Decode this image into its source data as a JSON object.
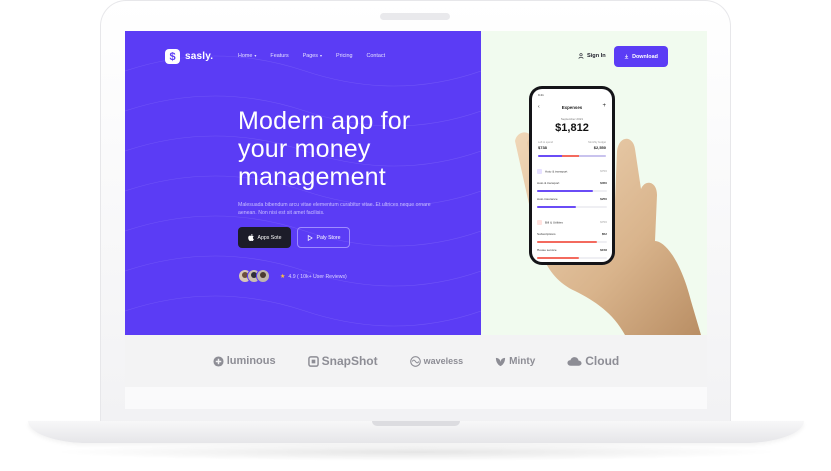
{
  "nav": {
    "logo": "sasly.",
    "logo_mark": "$",
    "items": [
      {
        "label": "Home",
        "has_caret": true
      },
      {
        "label": "Featurs",
        "has_caret": false
      },
      {
        "label": "Pages",
        "has_caret": true
      },
      {
        "label": "Pricing",
        "has_caret": false
      },
      {
        "label": "Contact",
        "has_caret": false
      }
    ],
    "signin": "Sign In",
    "download": "Download"
  },
  "hero": {
    "title_lines": [
      "Modern app for",
      "your money",
      "management"
    ],
    "description": "Malesuada bibendum arcu vitae elementum curabitur vitae. Et ultrices neque ornare aenean. Non nisi est sit amet facilisis.",
    "apps_button": "Apps Sote",
    "play_button": "Paly Store",
    "rating": "4.9 ( 10k+ User Reviews)"
  },
  "phone": {
    "time": "9:41",
    "title": "Expenses",
    "month": "September 2021",
    "amount": "$1,812",
    "left_to_spend_label": "Left to spend",
    "left_to_spend": "$738",
    "monthly_budget_label": "Monthly budget",
    "monthly_budget": "$2,550",
    "budget_bar": [
      0.35,
      0.25,
      0.4
    ],
    "items": [
      {
        "label": "Auto & transport",
        "amount": "$700",
        "sub": ""
      },
      {
        "label": "Auto & transport",
        "amount": "$350",
        "sub": "$200 left",
        "progress": 0.8,
        "color": "#6a4cf6"
      },
      {
        "label": "Auto insurance",
        "amount": "$250",
        "sub": "$200 left",
        "progress": 0.55,
        "color": "#6a4cf6"
      },
      {
        "label": "Bill & Utilities",
        "amount": "$700",
        "sub": ""
      },
      {
        "label": "Subscriptions",
        "amount": "$52",
        "sub": "$60 left",
        "progress": 0.85,
        "color": "#f36a5e"
      },
      {
        "label": "House service",
        "amount": "$158",
        "sub": "$112 left",
        "progress": 0.6,
        "color": "#f36a5e"
      }
    ]
  },
  "brands": [
    {
      "name": "luminous",
      "icon": "plus-circle-icon"
    },
    {
      "name": "SnapShot",
      "icon": "snapshot-icon"
    },
    {
      "name": "waveless",
      "icon": "wave-icon"
    },
    {
      "name": "Minty",
      "icon": "leaf-icon"
    },
    {
      "name": "Cloud",
      "icon": "cloud-icon"
    }
  ],
  "colors": {
    "primary": "#5b3cf5",
    "dark_button": "#1c1c29",
    "hero_right_bg": "#f1fbef",
    "brand_gray": "#8d8d95"
  }
}
